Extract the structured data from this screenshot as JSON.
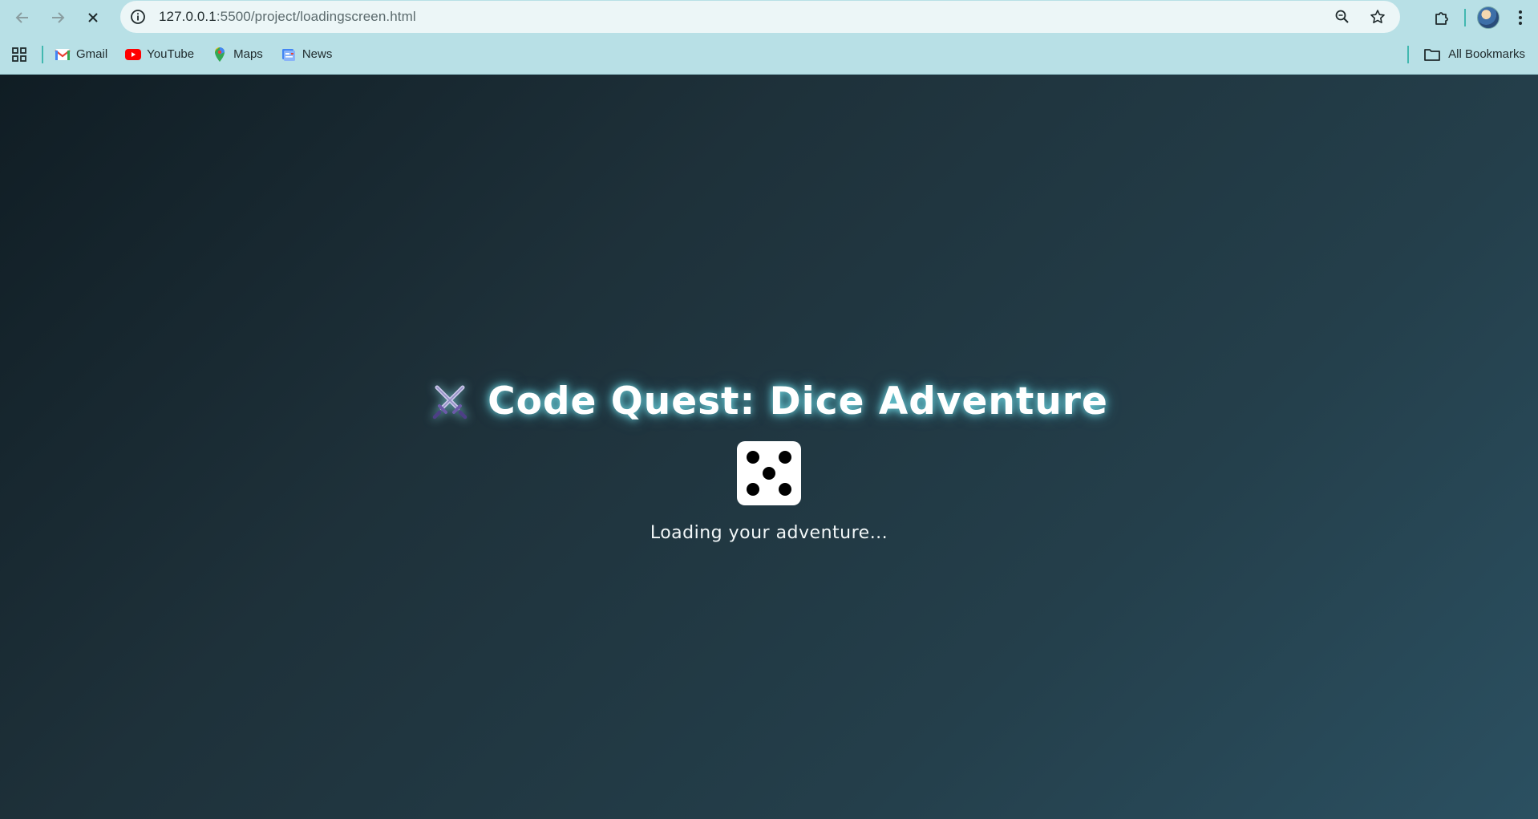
{
  "browser": {
    "url_host": "127.0.0.1",
    "url_rest": ":5500/project/loadingscreen.html",
    "back_icon": "arrow-left-icon",
    "forward_icon": "arrow-right-icon",
    "stop_icon": "close-icon"
  },
  "bookmarks": {
    "items": [
      {
        "label": "Gmail",
        "icon": "gmail-icon"
      },
      {
        "label": "YouTube",
        "icon": "youtube-icon"
      },
      {
        "label": "Maps",
        "icon": "maps-icon"
      },
      {
        "label": "News",
        "icon": "news-icon"
      }
    ],
    "all_label": "All Bookmarks"
  },
  "page": {
    "title": "Code Quest: Dice Adventure",
    "title_icon": "crossed-swords-icon",
    "die_face": 5,
    "loading_text": "Loading your adventure..."
  },
  "colors": {
    "chrome_bg": "#b8e0e6",
    "accent": "#42b8b0",
    "page_bg_start": "#101d24",
    "page_bg_end": "#2b5061",
    "title_glow": "#78e6f0"
  }
}
